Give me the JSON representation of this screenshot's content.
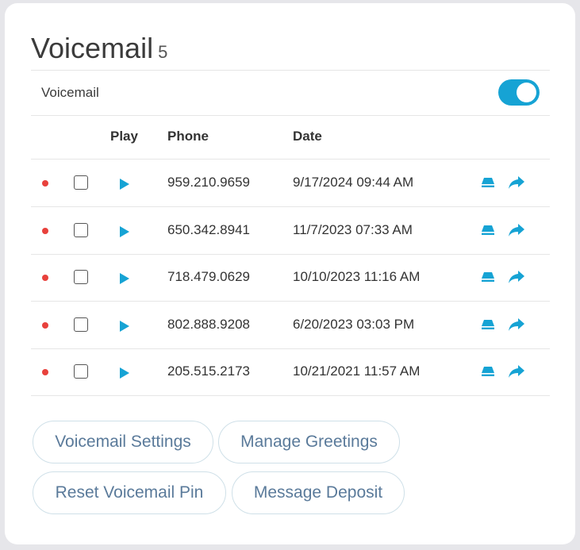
{
  "header": {
    "title": "Voicemail",
    "count": "5"
  },
  "toggle_row": {
    "label": "Voicemail",
    "enabled": true
  },
  "table": {
    "columns": {
      "play": "Play",
      "phone": "Phone",
      "date": "Date"
    },
    "rows": [
      {
        "phone": "959.210.9659",
        "date": "9/17/2024 09:44 AM",
        "unread": true,
        "checked": false
      },
      {
        "phone": "650.342.8941",
        "date": "11/7/2023 07:33 AM",
        "unread": true,
        "checked": false
      },
      {
        "phone": "718.479.0629",
        "date": "10/10/2023 11:16 AM",
        "unread": true,
        "checked": false
      },
      {
        "phone": "802.888.9208",
        "date": "6/20/2023 03:03 PM",
        "unread": true,
        "checked": false
      },
      {
        "phone": "205.515.2173",
        "date": "10/21/2021 11:57 AM",
        "unread": true,
        "checked": false
      }
    ],
    "row_icons": [
      "unread-dot",
      "checkbox",
      "play-icon",
      "save-icon",
      "forward-icon"
    ]
  },
  "buttons": {
    "voicemail_settings": "Voicemail Settings",
    "manage_greetings": "Manage Greetings",
    "reset_pin": "Reset Voicemail Pin",
    "message_deposit": "Message Deposit"
  },
  "colors": {
    "accent": "#16a3d4",
    "unread_dot": "#e8413c",
    "button_text": "#5a7a9a",
    "button_border": "#cfe0e8"
  }
}
